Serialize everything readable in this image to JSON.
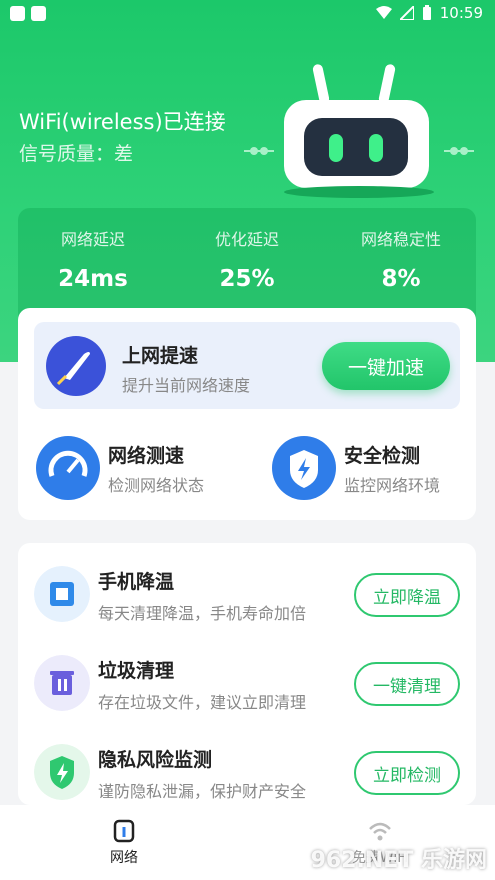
{
  "status_bar": {
    "time": "10:59"
  },
  "connection": {
    "title": "WiFi(wireless)已连接",
    "signal": "信号质量：差"
  },
  "stats": [
    {
      "label": "网络延迟",
      "value": "24ms"
    },
    {
      "label": "优化延迟",
      "value": "25%"
    },
    {
      "label": "网络稳定性",
      "value": "8%"
    }
  ],
  "boost": {
    "title": "上网提速",
    "subtitle": "提升当前网络速度",
    "button": "一键加速"
  },
  "features": [
    {
      "title": "网络测速",
      "subtitle": "检测网络状态"
    },
    {
      "title": "安全检测",
      "subtitle": "监控网络环境"
    }
  ],
  "tools": [
    {
      "title": "手机降温",
      "subtitle": "每天清理降温，手机寿命加倍",
      "button": "立即降温"
    },
    {
      "title": "垃圾清理",
      "subtitle": "存在垃圾文件，建议立即清理",
      "button": "一键清理"
    },
    {
      "title": "隐私风险监测",
      "subtitle": "谨防隐私泄漏，保护财产安全",
      "button": "立即检测"
    }
  ],
  "tabs": [
    {
      "label": "网络"
    },
    {
      "label": "免费WiFi"
    }
  ],
  "watermark": "962.NET 乐游网",
  "colors": {
    "primary": "#22c56a",
    "accent_blue": "#2f7de9"
  }
}
